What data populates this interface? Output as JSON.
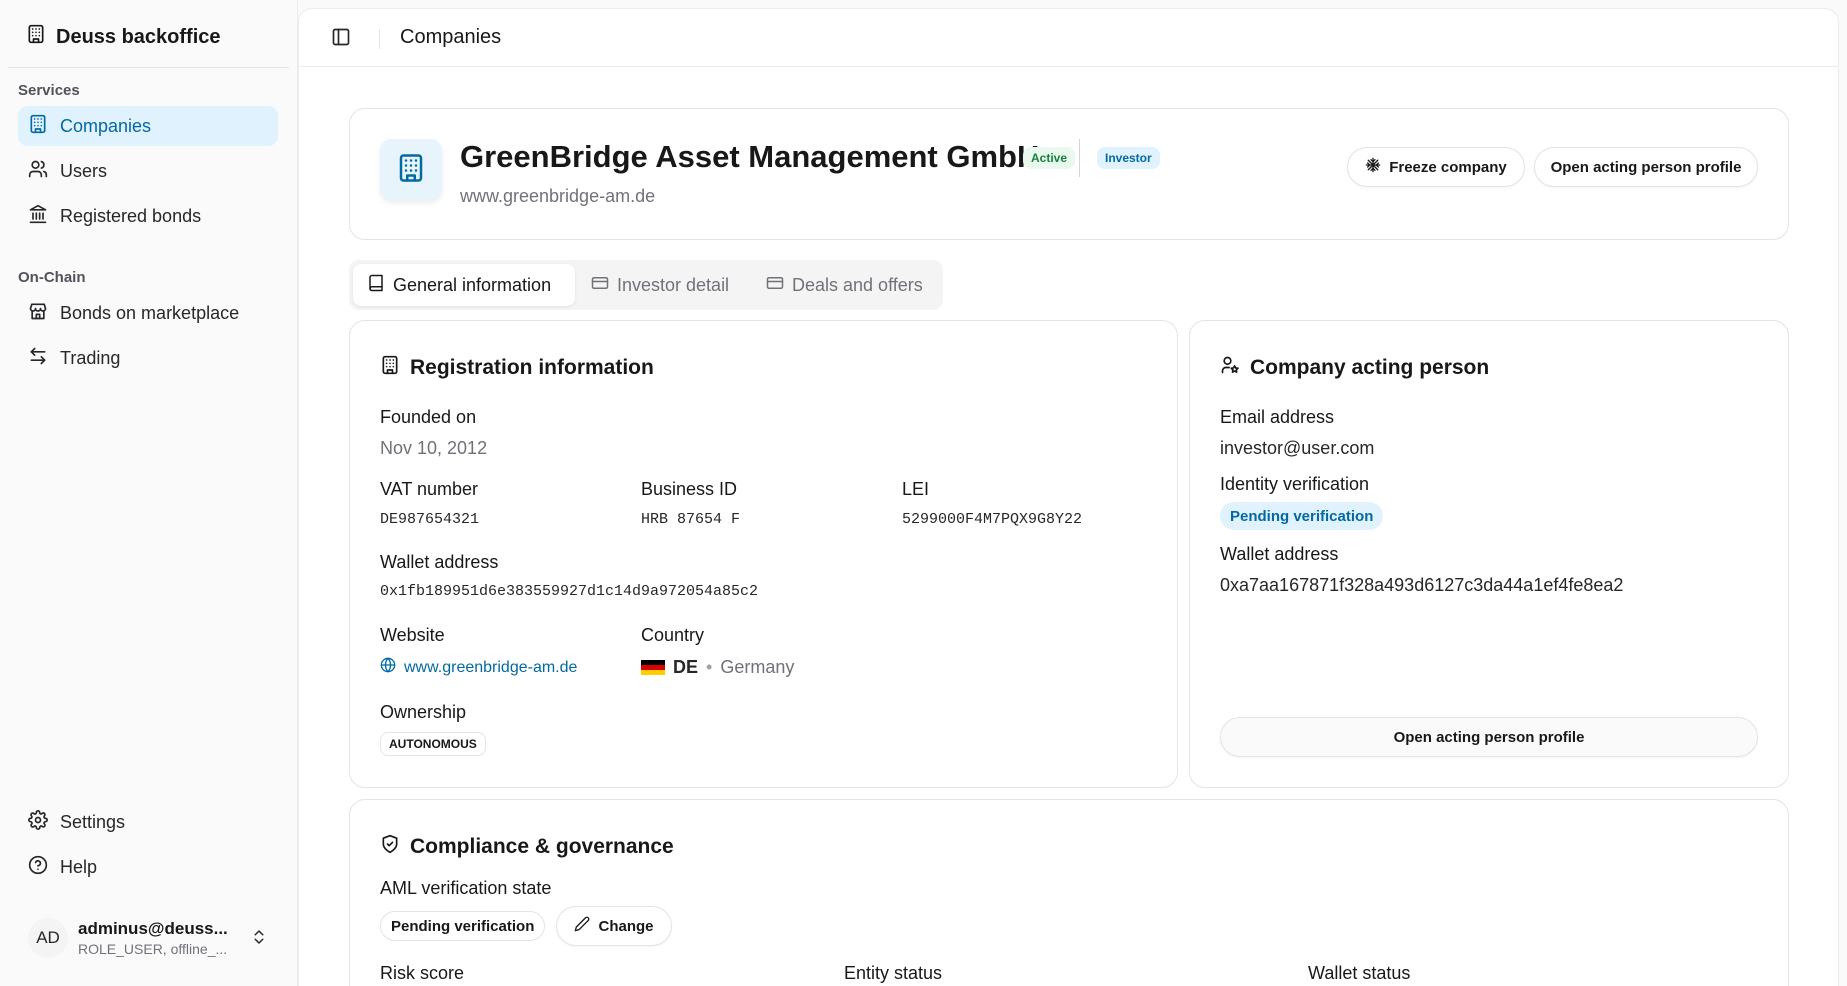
{
  "app": {
    "title": "Deuss backoffice"
  },
  "sidebar": {
    "sections": [
      {
        "label": "Services",
        "items": [
          {
            "label": "Companies",
            "icon": "building-icon",
            "active": true
          },
          {
            "label": "Users",
            "icon": "users-icon"
          },
          {
            "label": "Registered bonds",
            "icon": "landmark-icon"
          }
        ]
      },
      {
        "label": "On-Chain",
        "items": [
          {
            "label": "Bonds on marketplace",
            "icon": "store-icon"
          },
          {
            "label": "Trading",
            "icon": "arrows-swap-icon"
          }
        ]
      }
    ],
    "footer_items": [
      {
        "label": "Settings",
        "icon": "gear-icon"
      },
      {
        "label": "Help",
        "icon": "help-circle-icon"
      }
    ],
    "user": {
      "initials": "AD",
      "name": "adminus@deuss...",
      "role": "ROLE_USER, offline_..."
    }
  },
  "topbar": {
    "title": "Companies"
  },
  "company": {
    "name": "GreenBridge Asset Management GmbH",
    "status_badge": "Active",
    "type_badge": "Investor",
    "url": "www.greenbridge-am.de",
    "actions": {
      "freeze": "Freeze company",
      "open_profile": "Open acting person profile"
    }
  },
  "tabs": [
    {
      "label": "General information",
      "icon": "book-icon",
      "active": true
    },
    {
      "label": "Investor detail",
      "icon": "card-icon"
    },
    {
      "label": "Deals and offers",
      "icon": "card-icon"
    }
  ],
  "registration": {
    "title": "Registration information",
    "founded_label": "Founded on",
    "founded_value": "Nov 10, 2012",
    "vat_label": "VAT number",
    "vat_value": "DE987654321",
    "business_id_label": "Business ID",
    "business_id_value": "HRB 87654 F",
    "lei_label": "LEI",
    "lei_value": "5299000F4M7PQX9G8Y22",
    "wallet_label": "Wallet address",
    "wallet_value": "0x1fb189951d6e383559927d1c14d9a972054a85c2",
    "website_label": "Website",
    "website_value": "www.greenbridge-am.de",
    "country_label": "Country",
    "country_code": "DE",
    "country_separator": "•",
    "country_name": "Germany",
    "ownership_label": "Ownership",
    "ownership_value": "AUTONOMOUS"
  },
  "acting_person": {
    "title": "Company acting person",
    "email_label": "Email address",
    "email_value": "investor@user.com",
    "identity_label": "Identity verification",
    "identity_value": "Pending verification",
    "wallet_label": "Wallet address",
    "wallet_value": "0xa7aa167871f328a493d6127c3da44a1ef4fe8ea2",
    "open_profile_button": "Open acting person profile"
  },
  "compliance": {
    "title": "Compliance & governance",
    "aml_label": "AML verification state",
    "aml_value": "Pending verification",
    "change_button": "Change",
    "risk_label": "Risk score",
    "entity_label": "Entity status",
    "wallet_status_label": "Wallet status"
  },
  "colors": {
    "accent": "#0369a1",
    "accent_bg": "#e0f2fe",
    "success": "#15803d",
    "success_bg": "#e9f9ee"
  }
}
